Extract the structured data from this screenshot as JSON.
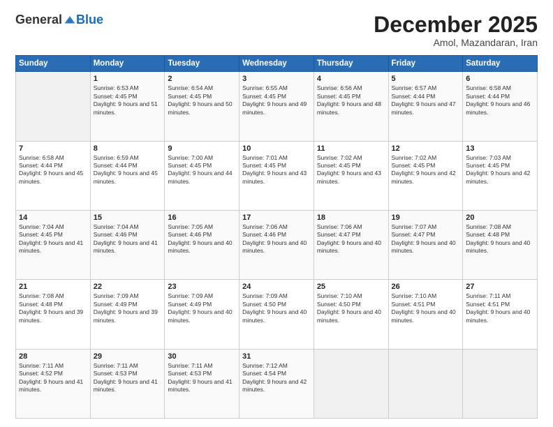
{
  "header": {
    "logo_general": "General",
    "logo_blue": "Blue",
    "title": "December 2025",
    "subtitle": "Amol, Mazandaran, Iran"
  },
  "weekdays": [
    "Sunday",
    "Monday",
    "Tuesday",
    "Wednesday",
    "Thursday",
    "Friday",
    "Saturday"
  ],
  "weeks": [
    [
      {
        "day": "",
        "sunrise": "",
        "sunset": "",
        "daylight": ""
      },
      {
        "day": "1",
        "sunrise": "Sunrise: 6:53 AM",
        "sunset": "Sunset: 4:45 PM",
        "daylight": "Daylight: 9 hours and 51 minutes."
      },
      {
        "day": "2",
        "sunrise": "Sunrise: 6:54 AM",
        "sunset": "Sunset: 4:45 PM",
        "daylight": "Daylight: 9 hours and 50 minutes."
      },
      {
        "day": "3",
        "sunrise": "Sunrise: 6:55 AM",
        "sunset": "Sunset: 4:45 PM",
        "daylight": "Daylight: 9 hours and 49 minutes."
      },
      {
        "day": "4",
        "sunrise": "Sunrise: 6:56 AM",
        "sunset": "Sunset: 4:45 PM",
        "daylight": "Daylight: 9 hours and 48 minutes."
      },
      {
        "day": "5",
        "sunrise": "Sunrise: 6:57 AM",
        "sunset": "Sunset: 4:44 PM",
        "daylight": "Daylight: 9 hours and 47 minutes."
      },
      {
        "day": "6",
        "sunrise": "Sunrise: 6:58 AM",
        "sunset": "Sunset: 4:44 PM",
        "daylight": "Daylight: 9 hours and 46 minutes."
      }
    ],
    [
      {
        "day": "7",
        "sunrise": "Sunrise: 6:58 AM",
        "sunset": "Sunset: 4:44 PM",
        "daylight": "Daylight: 9 hours and 45 minutes."
      },
      {
        "day": "8",
        "sunrise": "Sunrise: 6:59 AM",
        "sunset": "Sunset: 4:44 PM",
        "daylight": "Daylight: 9 hours and 45 minutes."
      },
      {
        "day": "9",
        "sunrise": "Sunrise: 7:00 AM",
        "sunset": "Sunset: 4:45 PM",
        "daylight": "Daylight: 9 hours and 44 minutes."
      },
      {
        "day": "10",
        "sunrise": "Sunrise: 7:01 AM",
        "sunset": "Sunset: 4:45 PM",
        "daylight": "Daylight: 9 hours and 43 minutes."
      },
      {
        "day": "11",
        "sunrise": "Sunrise: 7:02 AM",
        "sunset": "Sunset: 4:45 PM",
        "daylight": "Daylight: 9 hours and 43 minutes."
      },
      {
        "day": "12",
        "sunrise": "Sunrise: 7:02 AM",
        "sunset": "Sunset: 4:45 PM",
        "daylight": "Daylight: 9 hours and 42 minutes."
      },
      {
        "day": "13",
        "sunrise": "Sunrise: 7:03 AM",
        "sunset": "Sunset: 4:45 PM",
        "daylight": "Daylight: 9 hours and 42 minutes."
      }
    ],
    [
      {
        "day": "14",
        "sunrise": "Sunrise: 7:04 AM",
        "sunset": "Sunset: 4:45 PM",
        "daylight": "Daylight: 9 hours and 41 minutes."
      },
      {
        "day": "15",
        "sunrise": "Sunrise: 7:04 AM",
        "sunset": "Sunset: 4:46 PM",
        "daylight": "Daylight: 9 hours and 41 minutes."
      },
      {
        "day": "16",
        "sunrise": "Sunrise: 7:05 AM",
        "sunset": "Sunset: 4:46 PM",
        "daylight": "Daylight: 9 hours and 40 minutes."
      },
      {
        "day": "17",
        "sunrise": "Sunrise: 7:06 AM",
        "sunset": "Sunset: 4:46 PM",
        "daylight": "Daylight: 9 hours and 40 minutes."
      },
      {
        "day": "18",
        "sunrise": "Sunrise: 7:06 AM",
        "sunset": "Sunset: 4:47 PM",
        "daylight": "Daylight: 9 hours and 40 minutes."
      },
      {
        "day": "19",
        "sunrise": "Sunrise: 7:07 AM",
        "sunset": "Sunset: 4:47 PM",
        "daylight": "Daylight: 9 hours and 40 minutes."
      },
      {
        "day": "20",
        "sunrise": "Sunrise: 7:08 AM",
        "sunset": "Sunset: 4:48 PM",
        "daylight": "Daylight: 9 hours and 40 minutes."
      }
    ],
    [
      {
        "day": "21",
        "sunrise": "Sunrise: 7:08 AM",
        "sunset": "Sunset: 4:48 PM",
        "daylight": "Daylight: 9 hours and 39 minutes."
      },
      {
        "day": "22",
        "sunrise": "Sunrise: 7:09 AM",
        "sunset": "Sunset: 4:49 PM",
        "daylight": "Daylight: 9 hours and 39 minutes."
      },
      {
        "day": "23",
        "sunrise": "Sunrise: 7:09 AM",
        "sunset": "Sunset: 4:49 PM",
        "daylight": "Daylight: 9 hours and 40 minutes."
      },
      {
        "day": "24",
        "sunrise": "Sunrise: 7:09 AM",
        "sunset": "Sunset: 4:50 PM",
        "daylight": "Daylight: 9 hours and 40 minutes."
      },
      {
        "day": "25",
        "sunrise": "Sunrise: 7:10 AM",
        "sunset": "Sunset: 4:50 PM",
        "daylight": "Daylight: 9 hours and 40 minutes."
      },
      {
        "day": "26",
        "sunrise": "Sunrise: 7:10 AM",
        "sunset": "Sunset: 4:51 PM",
        "daylight": "Daylight: 9 hours and 40 minutes."
      },
      {
        "day": "27",
        "sunrise": "Sunrise: 7:11 AM",
        "sunset": "Sunset: 4:51 PM",
        "daylight": "Daylight: 9 hours and 40 minutes."
      }
    ],
    [
      {
        "day": "28",
        "sunrise": "Sunrise: 7:11 AM",
        "sunset": "Sunset: 4:52 PM",
        "daylight": "Daylight: 9 hours and 41 minutes."
      },
      {
        "day": "29",
        "sunrise": "Sunrise: 7:11 AM",
        "sunset": "Sunset: 4:53 PM",
        "daylight": "Daylight: 9 hours and 41 minutes."
      },
      {
        "day": "30",
        "sunrise": "Sunrise: 7:11 AM",
        "sunset": "Sunset: 4:53 PM",
        "daylight": "Daylight: 9 hours and 41 minutes."
      },
      {
        "day": "31",
        "sunrise": "Sunrise: 7:12 AM",
        "sunset": "Sunset: 4:54 PM",
        "daylight": "Daylight: 9 hours and 42 minutes."
      },
      {
        "day": "",
        "sunrise": "",
        "sunset": "",
        "daylight": ""
      },
      {
        "day": "",
        "sunrise": "",
        "sunset": "",
        "daylight": ""
      },
      {
        "day": "",
        "sunrise": "",
        "sunset": "",
        "daylight": ""
      }
    ]
  ]
}
